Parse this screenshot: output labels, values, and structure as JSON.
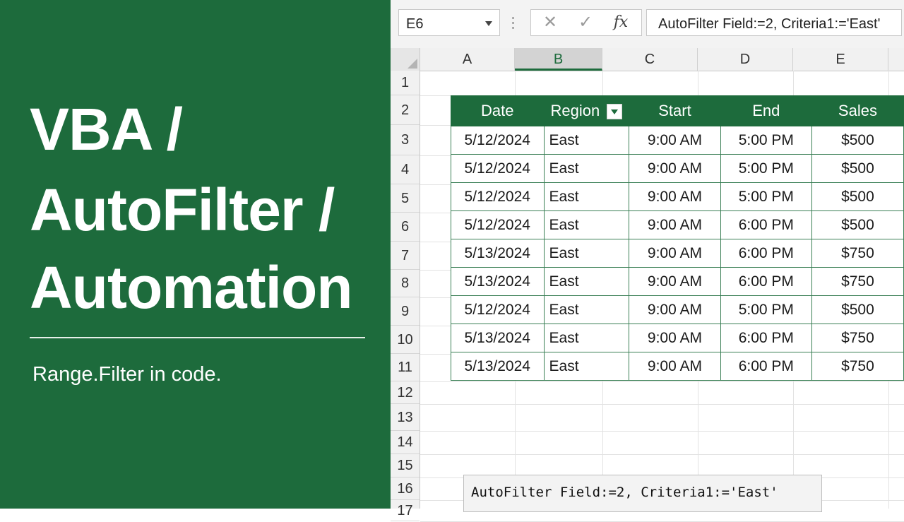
{
  "title": {
    "line1": "VBA /",
    "line2": "AutoFilter /",
    "line3": "Automation",
    "subtitle": "Range.Filter in code."
  },
  "formula_bar": {
    "name_box": "E6",
    "formula": "AutoFilter Field:=2, Criteria1:='East'",
    "cancel_icon": "✕",
    "enter_icon": "✓",
    "fx_label": "fx"
  },
  "columns": [
    "A",
    "B",
    "C",
    "D",
    "E"
  ],
  "selected_column": "B",
  "rows": [
    "1",
    "2",
    "3",
    "4",
    "5",
    "6",
    "7",
    "8",
    "9",
    "10",
    "11",
    "12",
    "13",
    "14",
    "15",
    "16",
    "17"
  ],
  "table": {
    "headers": [
      "Date",
      "Region",
      "Start",
      "End",
      "Sales"
    ],
    "filter_on_column": "Region",
    "data": [
      [
        "5/12/2024",
        "East",
        "9:00 AM",
        "5:00 PM",
        "$500"
      ],
      [
        "5/12/2024",
        "East",
        "9:00 AM",
        "5:00 PM",
        "$500"
      ],
      [
        "5/12/2024",
        "East",
        "9:00 AM",
        "5:00 PM",
        "$500"
      ],
      [
        "5/12/2024",
        "East",
        "9:00 AM",
        "6:00 PM",
        "$500"
      ],
      [
        "5/13/2024",
        "East",
        "9:00 AM",
        "6:00 PM",
        "$750"
      ],
      [
        "5/13/2024",
        "East",
        "9:00 AM",
        "6:00 PM",
        "$750"
      ],
      [
        "5/12/2024",
        "East",
        "9:00 AM",
        "5:00 PM",
        "$500"
      ],
      [
        "5/13/2024",
        "East",
        "9:00 AM",
        "6:00 PM",
        "$750"
      ],
      [
        "5/13/2024",
        "East",
        "9:00 AM",
        "6:00 PM",
        "$750"
      ]
    ]
  },
  "code_note": "AutoFilter Field:=2, Criteria1:='East'",
  "colors": {
    "brand_green": "#1d6b3c",
    "header_text": "#ffffff"
  }
}
